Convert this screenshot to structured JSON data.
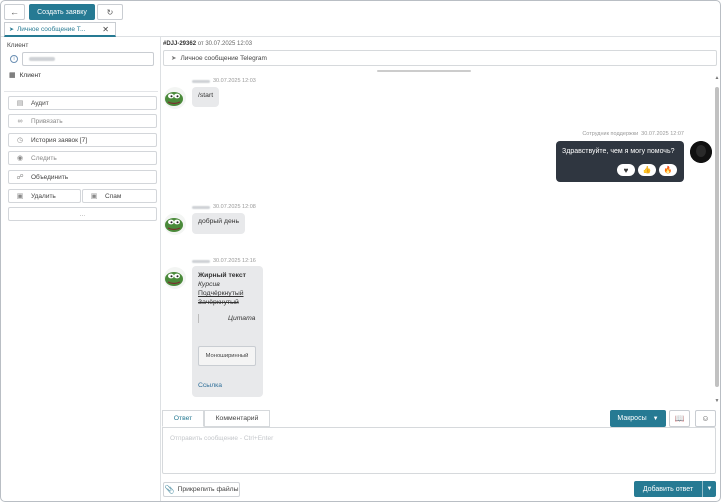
{
  "toolbar": {
    "create_ticket_label": "Создать заявку"
  },
  "tab": {
    "label": "Личное сообщение Т...",
    "close": "✕"
  },
  "client_panel": {
    "heading": "Клиент",
    "client_label": "Клиент",
    "actions": [
      {
        "label": "Аудит",
        "icon": "document-icon"
      },
      {
        "label": "Привязать",
        "icon": "link-icon"
      },
      {
        "label": "История заявок [7]",
        "icon": "history-icon"
      },
      {
        "label": "Следить",
        "icon": "eye-icon"
      },
      {
        "label": "Объединить",
        "icon": "merge-icon"
      }
    ],
    "delete_label": "Удалить",
    "spam_label": "Спам",
    "more_label": "..."
  },
  "ticket": {
    "id": "#DJJ-29362",
    "from_word": "от",
    "date": "30.07.2025 12:03",
    "channel": "Личное сообщение Telegram"
  },
  "messages": [
    {
      "direction": "in",
      "time": "30.07.2025 12:03",
      "text": "/start"
    },
    {
      "direction": "out",
      "author": "Сотрудник поддержки",
      "time": "30.07.2025 12:07",
      "text": "Здравствуйте, чем я могу помочь?",
      "reactions": [
        "♥",
        "👍",
        "🔥"
      ]
    },
    {
      "direction": "in",
      "time": "30.07.2025 12:08",
      "text": "добрый день"
    },
    {
      "direction": "in",
      "time": "30.07.2025 12:16",
      "rich": {
        "bold": "Жирный текст",
        "italic": "Курсив",
        "underline": "Подчёркнутый",
        "strike": "Зачёркнутый",
        "quote": "Цитата",
        "mono": "Моноширинный",
        "link": "Ссылка"
      }
    }
  ],
  "reply": {
    "tab_answer": "Ответ",
    "tab_comment": "Комментарий",
    "macros_label": "Макросы",
    "placeholder": "Отправить сообщение - Ctrl+Enter",
    "attach_label": "Прикрепить файлы",
    "add_reply_label": "Добавить ответ"
  },
  "colors": {
    "accent": "#267a93",
    "outgoing_bubble": "#2f3640",
    "incoming_bubble": "#e8e9eb"
  }
}
